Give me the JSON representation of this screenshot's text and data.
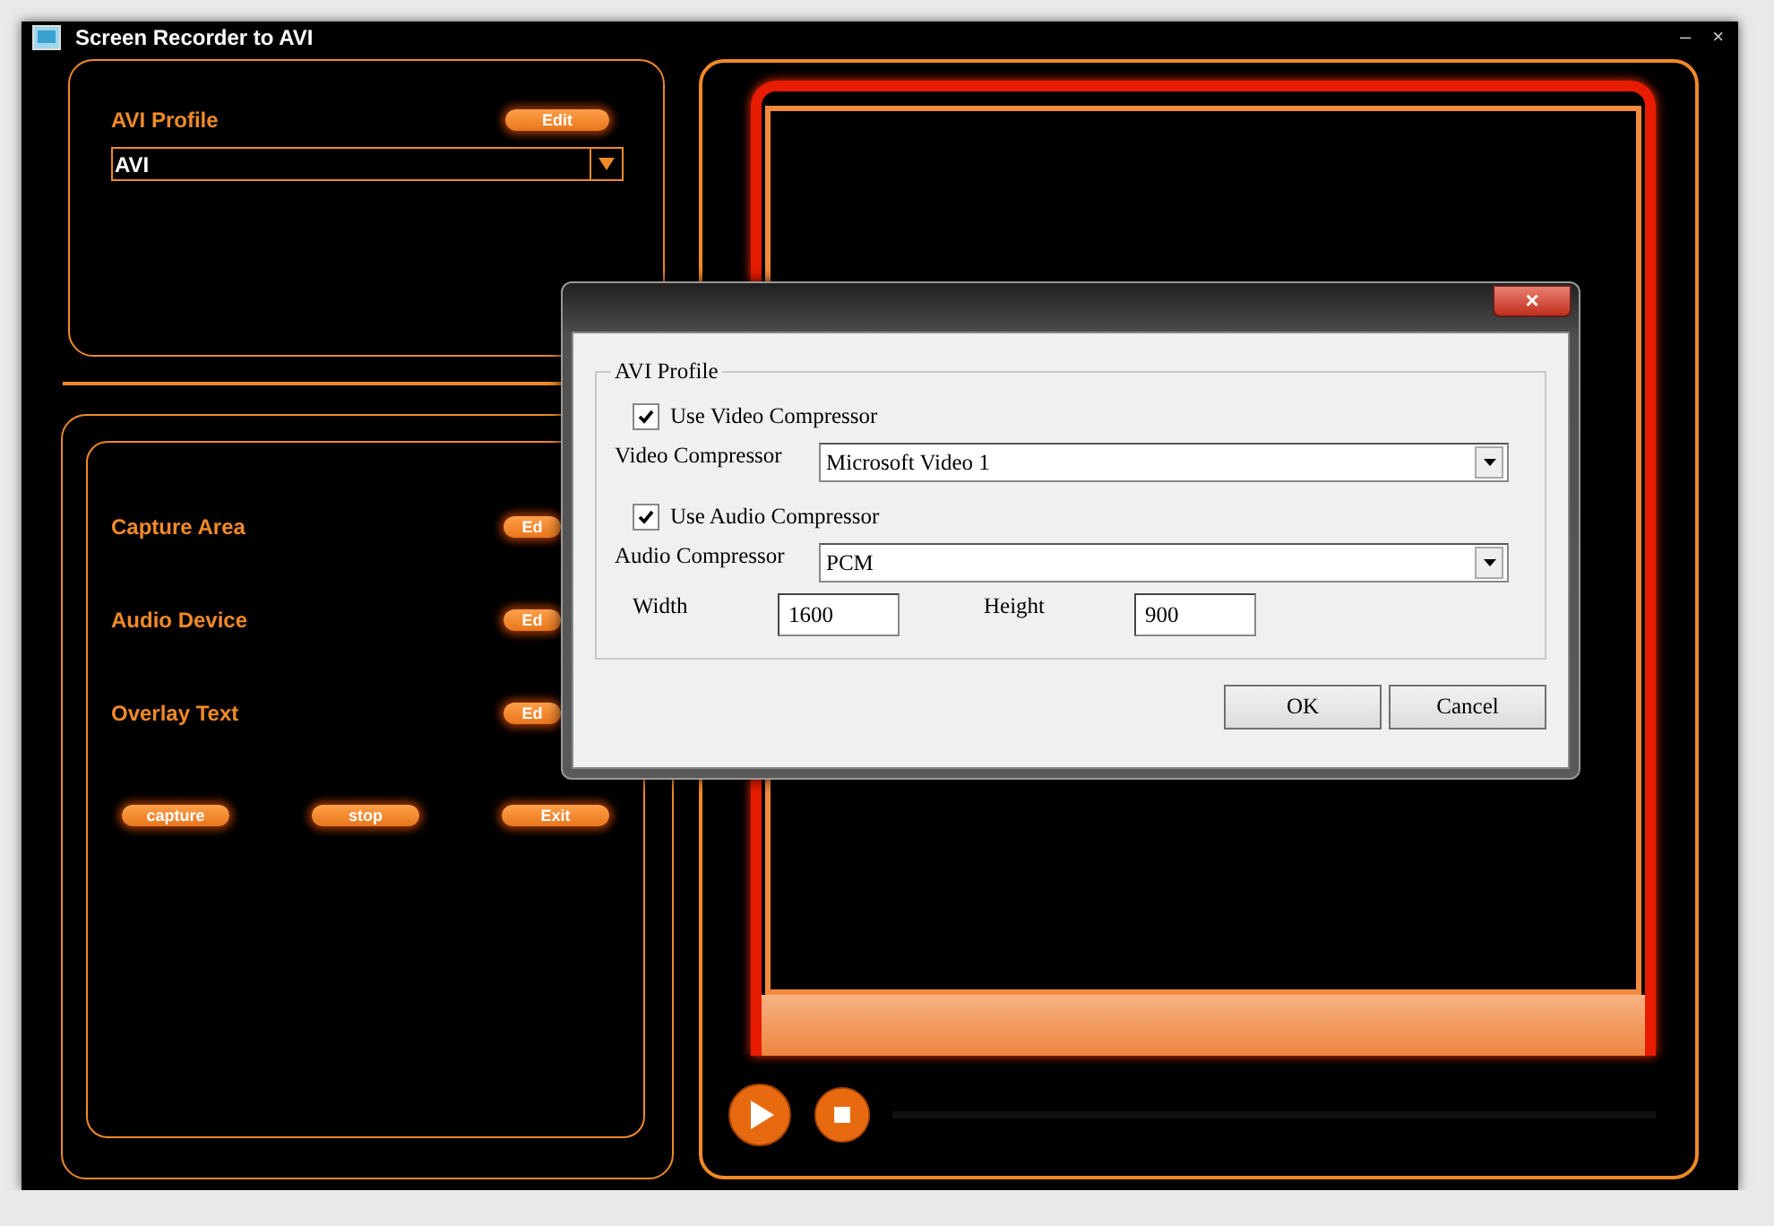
{
  "window": {
    "title": "Screen Recorder to AVI",
    "controls": [
      "–",
      "×"
    ]
  },
  "profile_panel": {
    "label": "AVI Profile",
    "edit_button": "Edit",
    "dropdown": {
      "value": "AVI"
    }
  },
  "settings_panel": {
    "rows": [
      {
        "label": "Capture Area",
        "button": "Ed"
      },
      {
        "label": "Audio Device",
        "button": "Ed"
      },
      {
        "label": "Overlay Text",
        "button": "Ed"
      }
    ],
    "buttons": [
      "capture",
      "stop",
      "Exit"
    ]
  },
  "dialog": {
    "close": "×",
    "group": "AVI Profile",
    "rows": [
      {
        "kind": "checkbox",
        "label": "Use Video Compressor",
        "checked": true
      },
      {
        "kind": "select",
        "label": "Video Compressor",
        "value": "Microsoft Video 1"
      },
      {
        "kind": "checkbox",
        "label": "Use Audio Compressor",
        "checked": true
      },
      {
        "kind": "select",
        "label": "Audio Compressor",
        "value": "PCM"
      },
      {
        "kind": "size",
        "fields": [
          {
            "label": "Width",
            "value": "1600"
          },
          {
            "label": "Height",
            "value": "900"
          }
        ]
      }
    ],
    "buttons": [
      "OK",
      "Cancel"
    ]
  }
}
